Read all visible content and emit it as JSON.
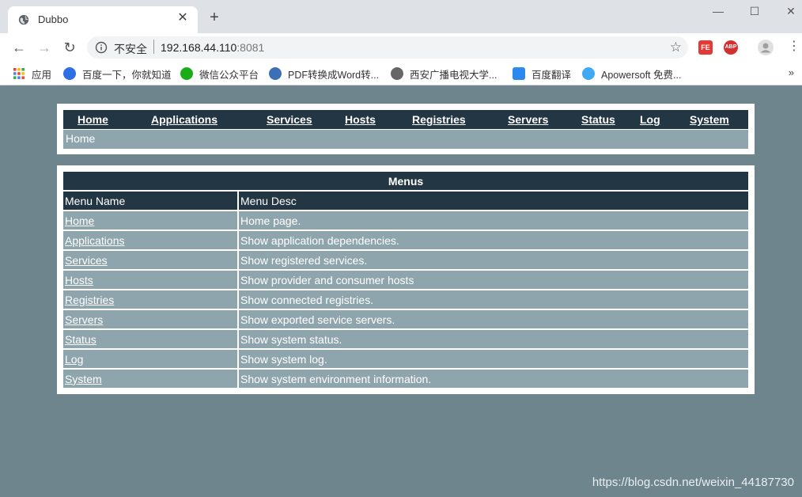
{
  "browser": {
    "tab_title": "Dubbo",
    "tab_close": "✕",
    "new_tab": "+",
    "insecure_label": "不安全",
    "url_host": "192.168.44.110",
    "url_port": ":8081",
    "window": {
      "minimize": "—",
      "maximize": "☐",
      "close": "✕"
    },
    "nav": {
      "back": "←",
      "forward": "→",
      "reload": "↻"
    },
    "extensions": [
      {
        "label": "FE",
        "color": "#e53935"
      },
      {
        "label": "ABP",
        "color": "#d32f2f"
      }
    ],
    "bookmarks": [
      {
        "label": "应用",
        "icon_color": "#e8453c"
      },
      {
        "label": "百度一下，你就知道",
        "icon_color": "#2f6fe4"
      },
      {
        "label": "微信公众平台",
        "icon_color": "#1aad19"
      },
      {
        "label": "PDF转换成Word转...",
        "icon_color": "#3b6fb6"
      },
      {
        "label": "西安广播电视大学...",
        "icon_color": "#666666"
      },
      {
        "label": "百度翻译",
        "icon_color": "#2b89f0"
      },
      {
        "label": "Apowersoft 免费...",
        "icon_color": "#3fa9f5"
      }
    ],
    "bookmarks_more": "»"
  },
  "nav": {
    "links": [
      "Home",
      "Applications",
      "Services",
      "Hosts",
      "Registries",
      "Servers",
      "Status",
      "Log",
      "System"
    ],
    "breadcrumb": "Home"
  },
  "menus": {
    "title": "Menus",
    "col_name": "Menu Name",
    "col_desc": "Menu Desc",
    "rows": [
      {
        "name": "Home",
        "desc": "Home page."
      },
      {
        "name": "Applications",
        "desc": "Show application dependencies."
      },
      {
        "name": "Services",
        "desc": "Show registered services."
      },
      {
        "name": "Hosts",
        "desc": "Show provider and consumer hosts"
      },
      {
        "name": "Registries",
        "desc": "Show connected registries."
      },
      {
        "name": "Servers",
        "desc": "Show exported service servers."
      },
      {
        "name": "Status",
        "desc": "Show system status."
      },
      {
        "name": "Log",
        "desc": "Show system log."
      },
      {
        "name": "System",
        "desc": "Show system environment information."
      }
    ]
  },
  "watermark": "https://blog.csdn.net/weixin_44187730",
  "colors": {
    "page_bg": "#6f858d",
    "dark": "#223644",
    "row": "#8fa5ad"
  }
}
